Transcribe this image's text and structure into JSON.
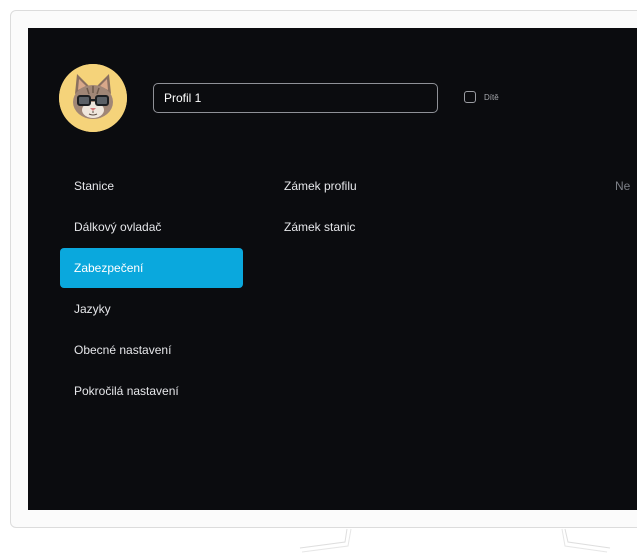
{
  "profile": {
    "name_value": "Profil 1",
    "child_label": "Dítě",
    "child_checked": false
  },
  "menu": {
    "items": [
      {
        "label": "Stanice",
        "active": false
      },
      {
        "label": "Dálkový ovladač",
        "active": false
      },
      {
        "label": "Zabezpečení",
        "active": true
      },
      {
        "label": "Jazyky",
        "active": false
      },
      {
        "label": "Obecné nastavení",
        "active": false
      },
      {
        "label": "Pokročilá nastavení",
        "active": false
      }
    ]
  },
  "security": {
    "rows": [
      {
        "label": "Zámek profilu",
        "value": "Ne"
      },
      {
        "label": "Zámek stanic",
        "value": ""
      }
    ]
  },
  "colors": {
    "accent": "#0aa8dd",
    "background": "#0b0c0f",
    "avatar_bg": "#f5d37a"
  },
  "icons": {
    "avatar": "cat-with-glasses-avatar",
    "checkbox": "checkbox-unchecked"
  }
}
